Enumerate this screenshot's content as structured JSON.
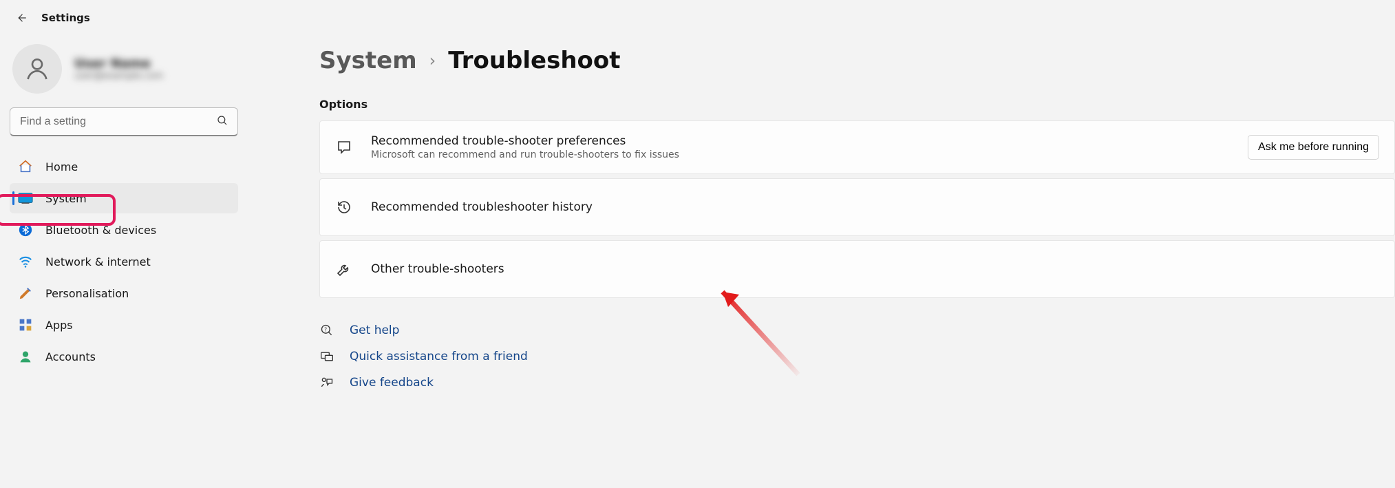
{
  "window": {
    "title": "Settings"
  },
  "profile": {
    "name": "User Name",
    "email": "user@example.com"
  },
  "search": {
    "placeholder": "Find a setting"
  },
  "sidebar": {
    "items": [
      {
        "id": "home",
        "label": "Home"
      },
      {
        "id": "system",
        "label": "System"
      },
      {
        "id": "bluetooth",
        "label": "Bluetooth & devices"
      },
      {
        "id": "network",
        "label": "Network & internet"
      },
      {
        "id": "personalisation",
        "label": "Personalisation"
      },
      {
        "id": "apps",
        "label": "Apps"
      },
      {
        "id": "accounts",
        "label": "Accounts"
      }
    ],
    "selected": "system"
  },
  "breadcrumbs": {
    "parent": "System",
    "current": "Troubleshoot"
  },
  "main": {
    "section_heading": "Options",
    "cards": {
      "recommended_prefs": {
        "title": "Recommended trouble-shooter preferences",
        "subtitle": "Microsoft can recommend and run trouble-shooters to fix issues",
        "action_label": "Ask me before running"
      },
      "history": {
        "title": "Recommended troubleshooter history"
      },
      "other": {
        "title": "Other trouble-shooters"
      }
    },
    "help_links": {
      "get_help": "Get help",
      "quick_assist": "Quick assistance from a friend",
      "feedback": "Give feedback"
    }
  },
  "colors": {
    "accent": "#1a6fd8",
    "link": "#15468a",
    "highlight_box": "#e11a5b"
  }
}
